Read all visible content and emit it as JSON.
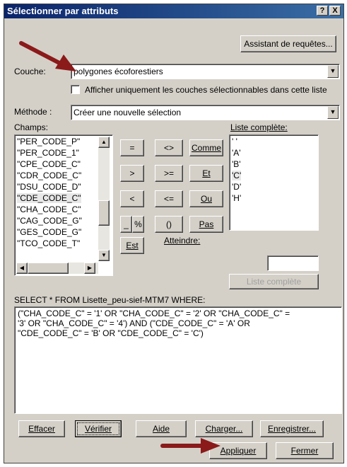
{
  "window": {
    "title": "Sélectionner par attributs",
    "help_button": "?",
    "close_button": "X"
  },
  "assistant_button": "Assistant de requêtes...",
  "couche": {
    "label": "Couche:",
    "value": "polygones écoforestiers"
  },
  "checkbox_label": "Afficher uniquement les couches sélectionnables dans cette liste",
  "methode": {
    "label": "Méthode :",
    "value": "Créer une nouvelle sélection"
  },
  "champs": {
    "label": "Champs:",
    "items": [
      "\"PER_CODE_P\"",
      "\"PER_CODE_1\"",
      "\"CPE_CODE_C\"",
      "\"CDR_CODE_C\"",
      "\"DSU_CODE_D\"",
      "\"CDE_CODE_C\"",
      "\"CHA_CODE_C\"",
      "\"CAG_CODE_G\"",
      "\"GES_CODE_G\"",
      "\"TCO_CODE_T\""
    ],
    "selected": "\"CDE_CODE_C\""
  },
  "operators": [
    "=",
    "<>",
    "Comme",
    ">",
    ">=",
    "Et",
    "<",
    "<=",
    "Ou",
    "_",
    "%",
    "()",
    "Pas",
    "Est"
  ],
  "liste": {
    "label": "Liste complète:",
    "items": [
      "' '",
      "'A'",
      "'B'",
      "'C'",
      "'D'",
      "'H'"
    ],
    "selected": "'C'"
  },
  "atteindre": {
    "label": "Atteindre:",
    "value": ""
  },
  "liste_button": "Liste complète",
  "sql_header": "SELECT * FROM Lisette_peu-sief-MTM7 WHERE:",
  "sql_text": "(\"CHA_CODE_C\" = '1' OR \"CHA_CODE_C\" = '2' OR \"CHA_CODE_C\" =\n'3' OR \"CHA_CODE_C\" = '4') AND (\"CDE_CODE_C\" = 'A' OR\n\"CDE_CODE_C\" = 'B' OR \"CDE_CODE_C\" = 'C')",
  "buttons": {
    "effacer": "Effacer",
    "verifier": "Vérifier",
    "aide": "Aide",
    "charger": "Charger...",
    "enregistrer": "Enregistrer...",
    "appliquer": "Appliquer",
    "fermer": "Fermer"
  },
  "colors": {
    "title_start": "#0a246a",
    "title_end": "#3a6ea5",
    "dialog": "#d4d0c8",
    "annotation_arrow": "#8b1a1a"
  },
  "icons": [
    "help-icon",
    "close-icon",
    "dropdown-arrow-icon",
    "scroll-up-icon",
    "scroll-down-icon",
    "scroll-left-icon",
    "scroll-right-icon",
    "annotation-arrow-icon"
  ]
}
